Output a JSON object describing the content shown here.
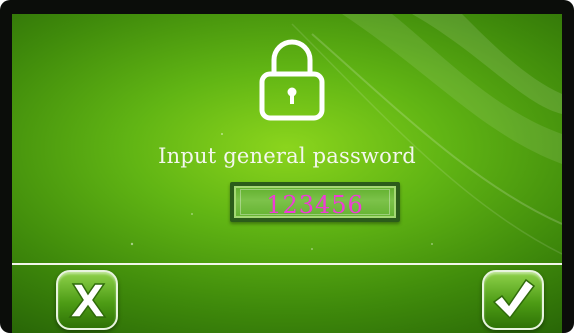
{
  "dialog": {
    "prompt": "Input general password",
    "password_value": "123456"
  },
  "icons": {
    "lock": "lock-icon",
    "cancel": "x-icon",
    "confirm": "checkmark-icon"
  },
  "colors": {
    "background_green": "#61b514",
    "password_text": "#ef3bd6",
    "prompt_text": "#f4f7ee"
  }
}
